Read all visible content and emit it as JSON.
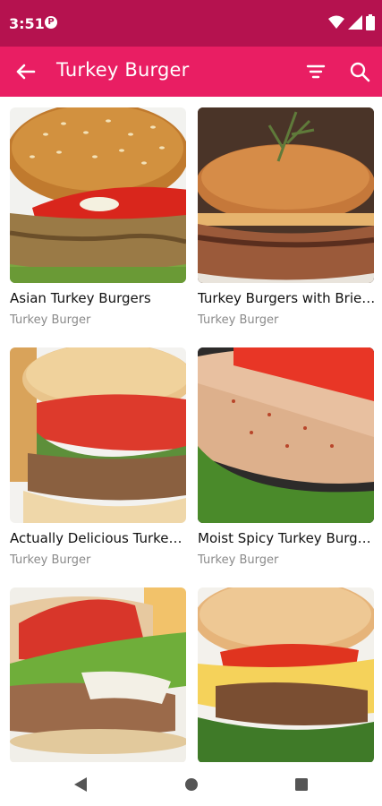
{
  "status": {
    "time": "3:51",
    "notif_icon": "app-notification-icon"
  },
  "appbar": {
    "title": "Turkey Burger",
    "back_icon": "arrow-back-icon",
    "filter_icon": "filter-icon",
    "search_icon": "search-icon"
  },
  "colors": {
    "statusbar": "#b5124f",
    "appbar": "#e91e63",
    "category_text": "#8a8a8a"
  },
  "recipes": [
    {
      "name": "Asian Turkey Burgers",
      "category": "Turkey Burger"
    },
    {
      "name": "Turkey Burgers with Brie…",
      "category": "Turkey Burger"
    },
    {
      "name": "Actually Delicious Turke…",
      "category": "Turkey Burger"
    },
    {
      "name": "Moist Spicy Turkey Burg…",
      "category": "Turkey Burger"
    },
    {
      "name": "",
      "category": ""
    },
    {
      "name": "",
      "category": ""
    }
  ],
  "navbar": {
    "back": "nav-back-icon",
    "home": "nav-home-icon",
    "recents": "nav-recents-icon"
  }
}
